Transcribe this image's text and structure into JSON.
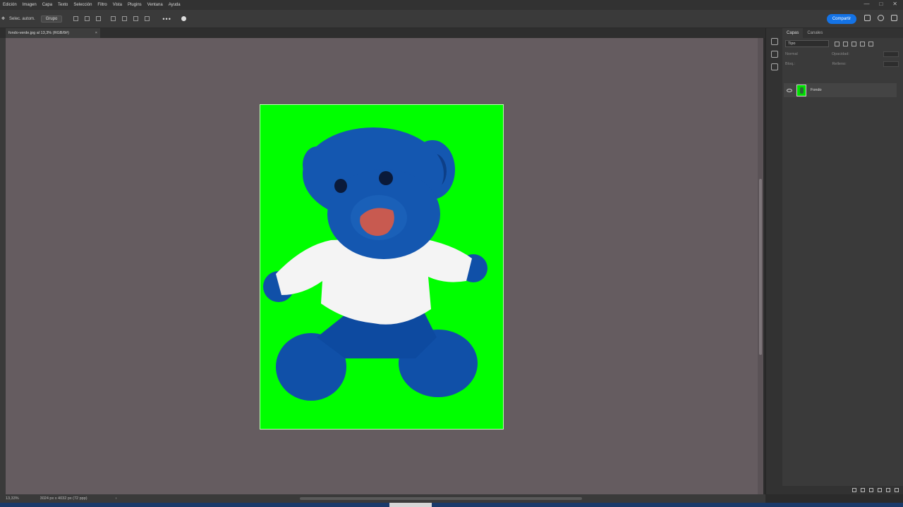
{
  "menubar": {
    "items": [
      "Edición",
      "Imagen",
      "Capa",
      "Texto",
      "Selección",
      "Filtro",
      "Vista",
      "Plugins",
      "Ventana",
      "Ayuda"
    ],
    "window_controls": [
      "—",
      "□",
      "✕"
    ]
  },
  "optionsbar": {
    "auto_select_label": "Selec. autom.",
    "auto_select_value": "Grupo",
    "more_label": "•••",
    "share_label": "Compartir"
  },
  "tab": {
    "title": "fondo-verde.jpg al 13,3% (RGB/8#)",
    "close_label": "×"
  },
  "status": {
    "zoom": "13,33%",
    "doc_size": "3024 px x 4032 px (72 ppp)",
    "arrow": "›"
  },
  "panel": {
    "tabs": [
      "Capas",
      "Canales"
    ],
    "filter_value": "Tipo",
    "mode_label": "Normal",
    "opacity_label": "Opacidad:",
    "lock_label": "Bloq.:",
    "fill_label": "Relleno:",
    "layer_name": "Fondo"
  },
  "colors": {
    "canvas_background": "#655c60",
    "document_fill": "#00ff00",
    "accent": "#1473e6",
    "bear_blue": "#1050a8",
    "shirt": "#f4f4f4",
    "nose": "#c85a50"
  }
}
